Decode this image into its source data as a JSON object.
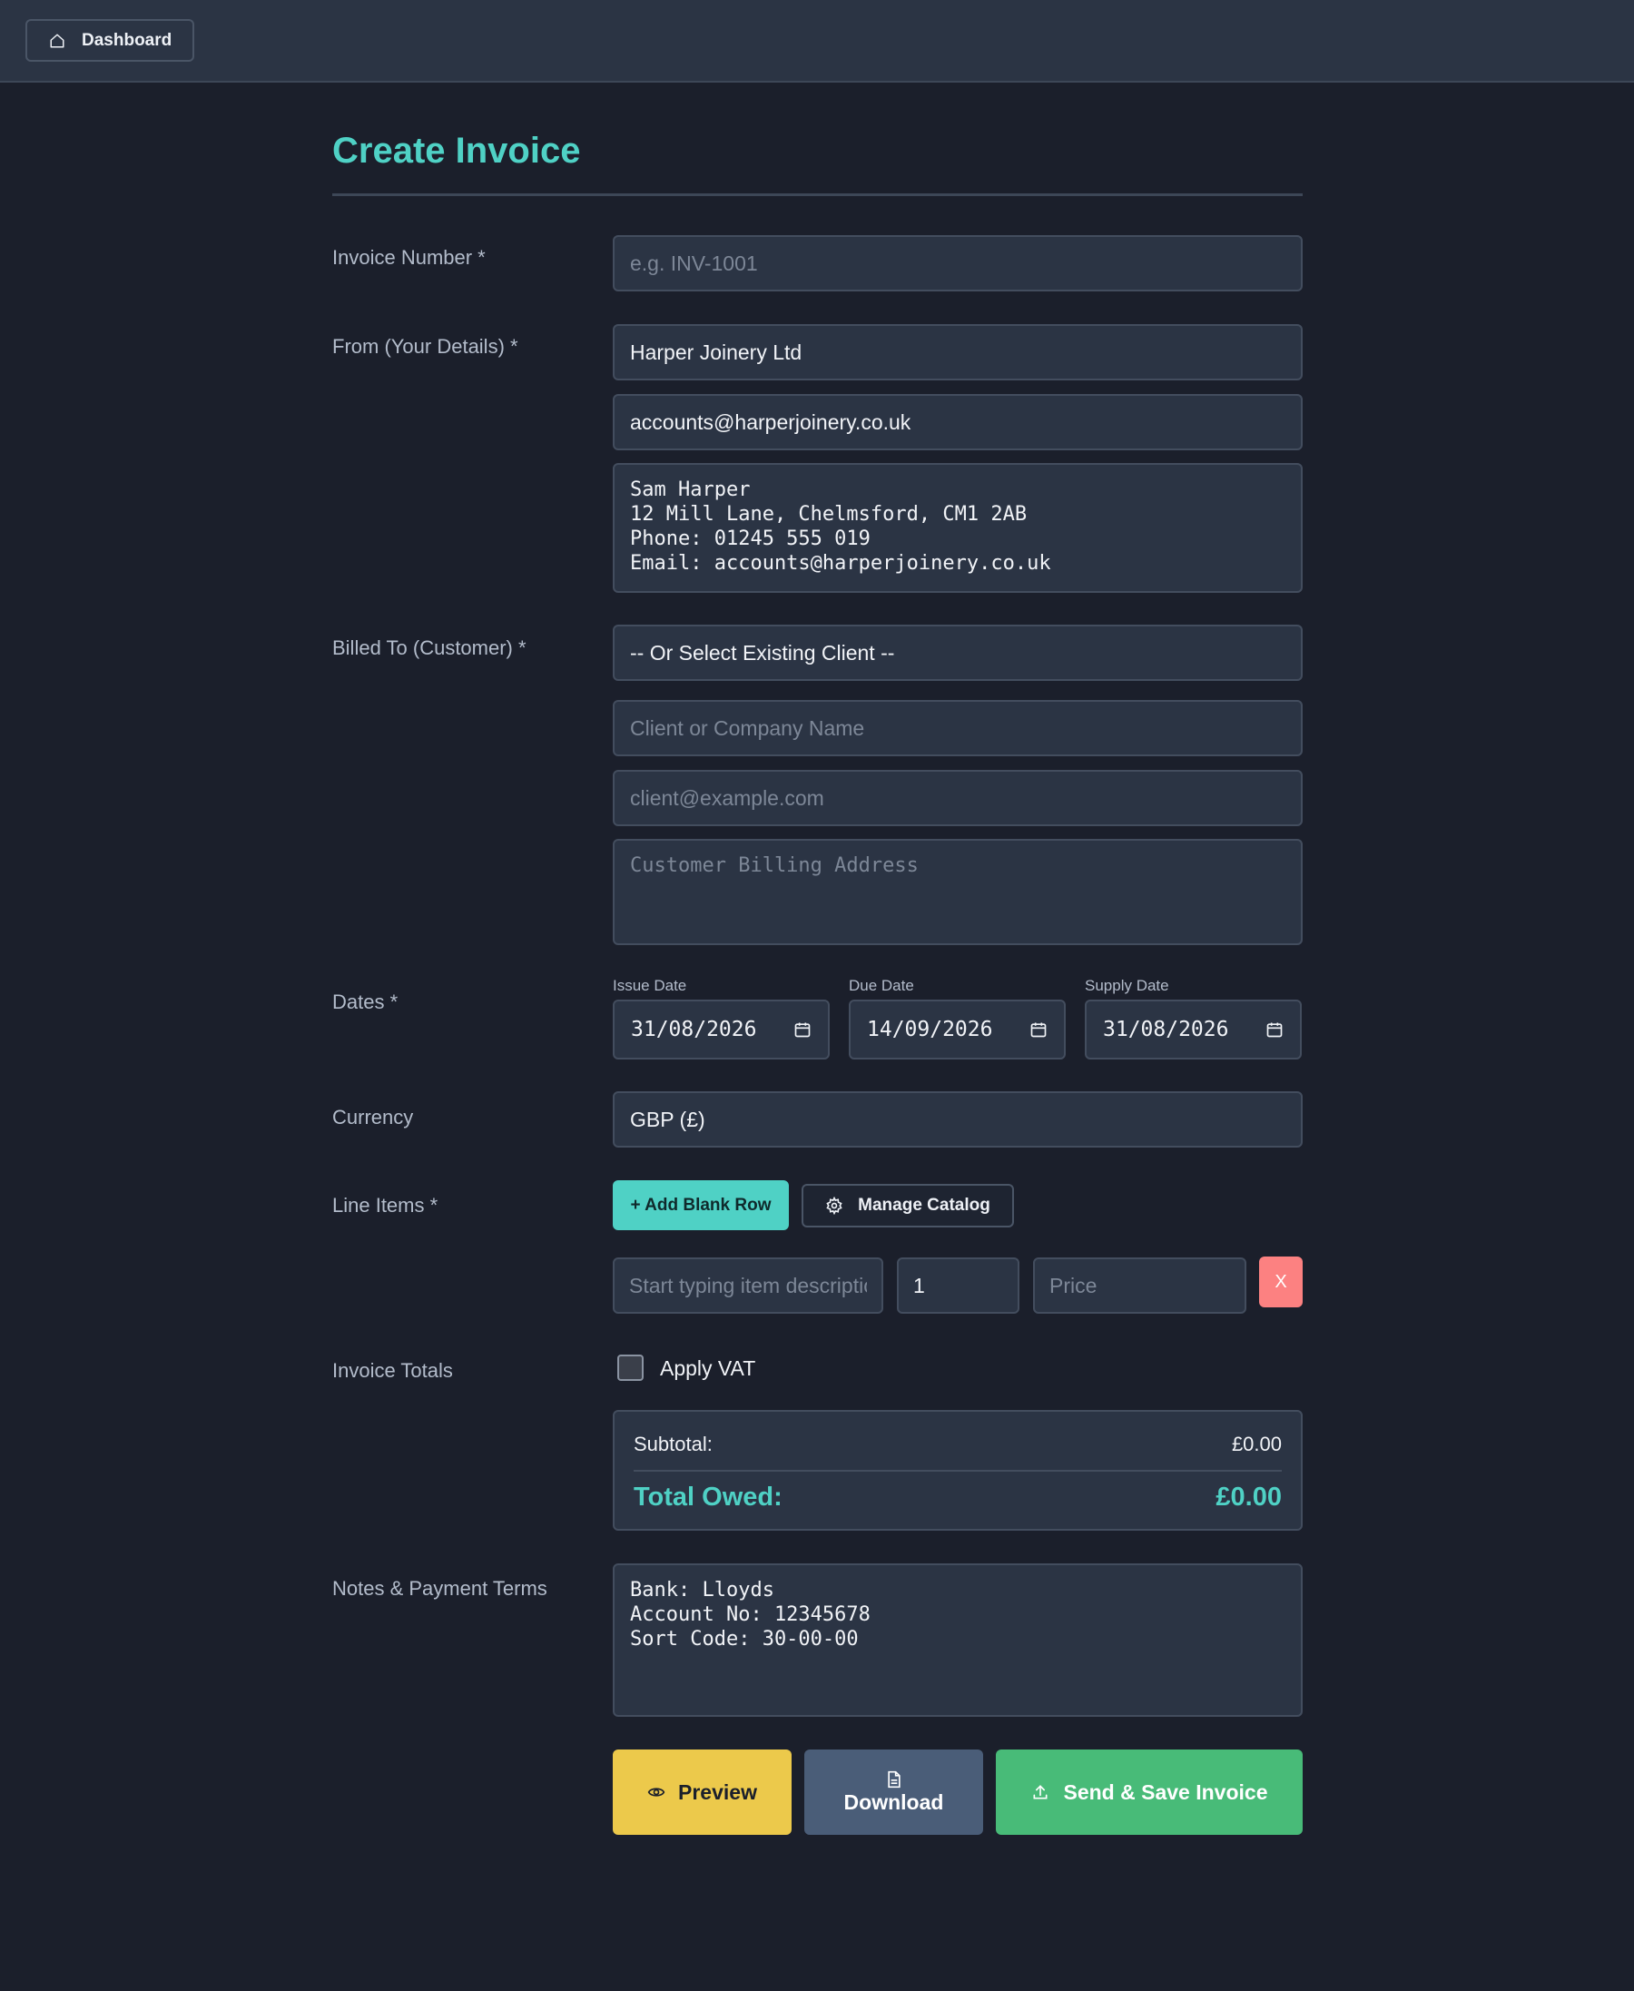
{
  "topbar": {
    "dashboard_label": "Dashboard"
  },
  "page": {
    "title": "Create Invoice"
  },
  "invoice_number": {
    "label": "Invoice Number *",
    "placeholder": "e.g. INV-1001",
    "value": ""
  },
  "from": {
    "label": "From (Your Details) *",
    "company": "Harper Joinery Ltd",
    "email": "accounts@harperjoinery.co.uk",
    "details": "Sam Harper\n12 Mill Lane, Chelmsford, CM1 2AB\nPhone: 01245 555 019\nEmail: accounts@harperjoinery.co.uk"
  },
  "billed_to": {
    "label": "Billed To (Customer) *",
    "client_select": "-- Or Select Existing Client --",
    "name_placeholder": "Client or Company Name",
    "email_placeholder": "client@example.com",
    "address_placeholder": "Customer Billing Address"
  },
  "dates": {
    "label": "Dates *",
    "issue_label": "Issue Date",
    "issue_value": "31/08/2026",
    "due_label": "Due Date",
    "due_value": "14/09/2026",
    "supply_label": "Supply Date",
    "supply_value": "31/08/2026"
  },
  "currency": {
    "label": "Currency",
    "value": "GBP (£)"
  },
  "line_items": {
    "label": "Line Items *",
    "add_row_label": "+ Add Blank Row",
    "manage_catalog_label": "Manage Catalog",
    "description_placeholder": "Start typing item description",
    "quantity_value": "1",
    "price_placeholder": "Price",
    "remove_label": "X"
  },
  "totals": {
    "label": "Invoice Totals",
    "apply_vat_label": "Apply VAT",
    "apply_vat_checked": false,
    "subtotal_label": "Subtotal:",
    "subtotal_value": "£0.00",
    "total_label": "Total Owed:",
    "total_value": "£0.00"
  },
  "notes": {
    "label": "Notes & Payment Terms",
    "value": "Bank: Lloyds\nAccount No: 12345678\nSort Code: 30-00-00"
  },
  "actions": {
    "preview_label": "Preview",
    "download_label": "Download",
    "send_label": "Send & Save Invoice"
  },
  "colors": {
    "accent": "#4fd1c5",
    "preview": "#ecc94b",
    "download": "#4a5d78",
    "send": "#48bb78",
    "danger": "#fc8181"
  }
}
